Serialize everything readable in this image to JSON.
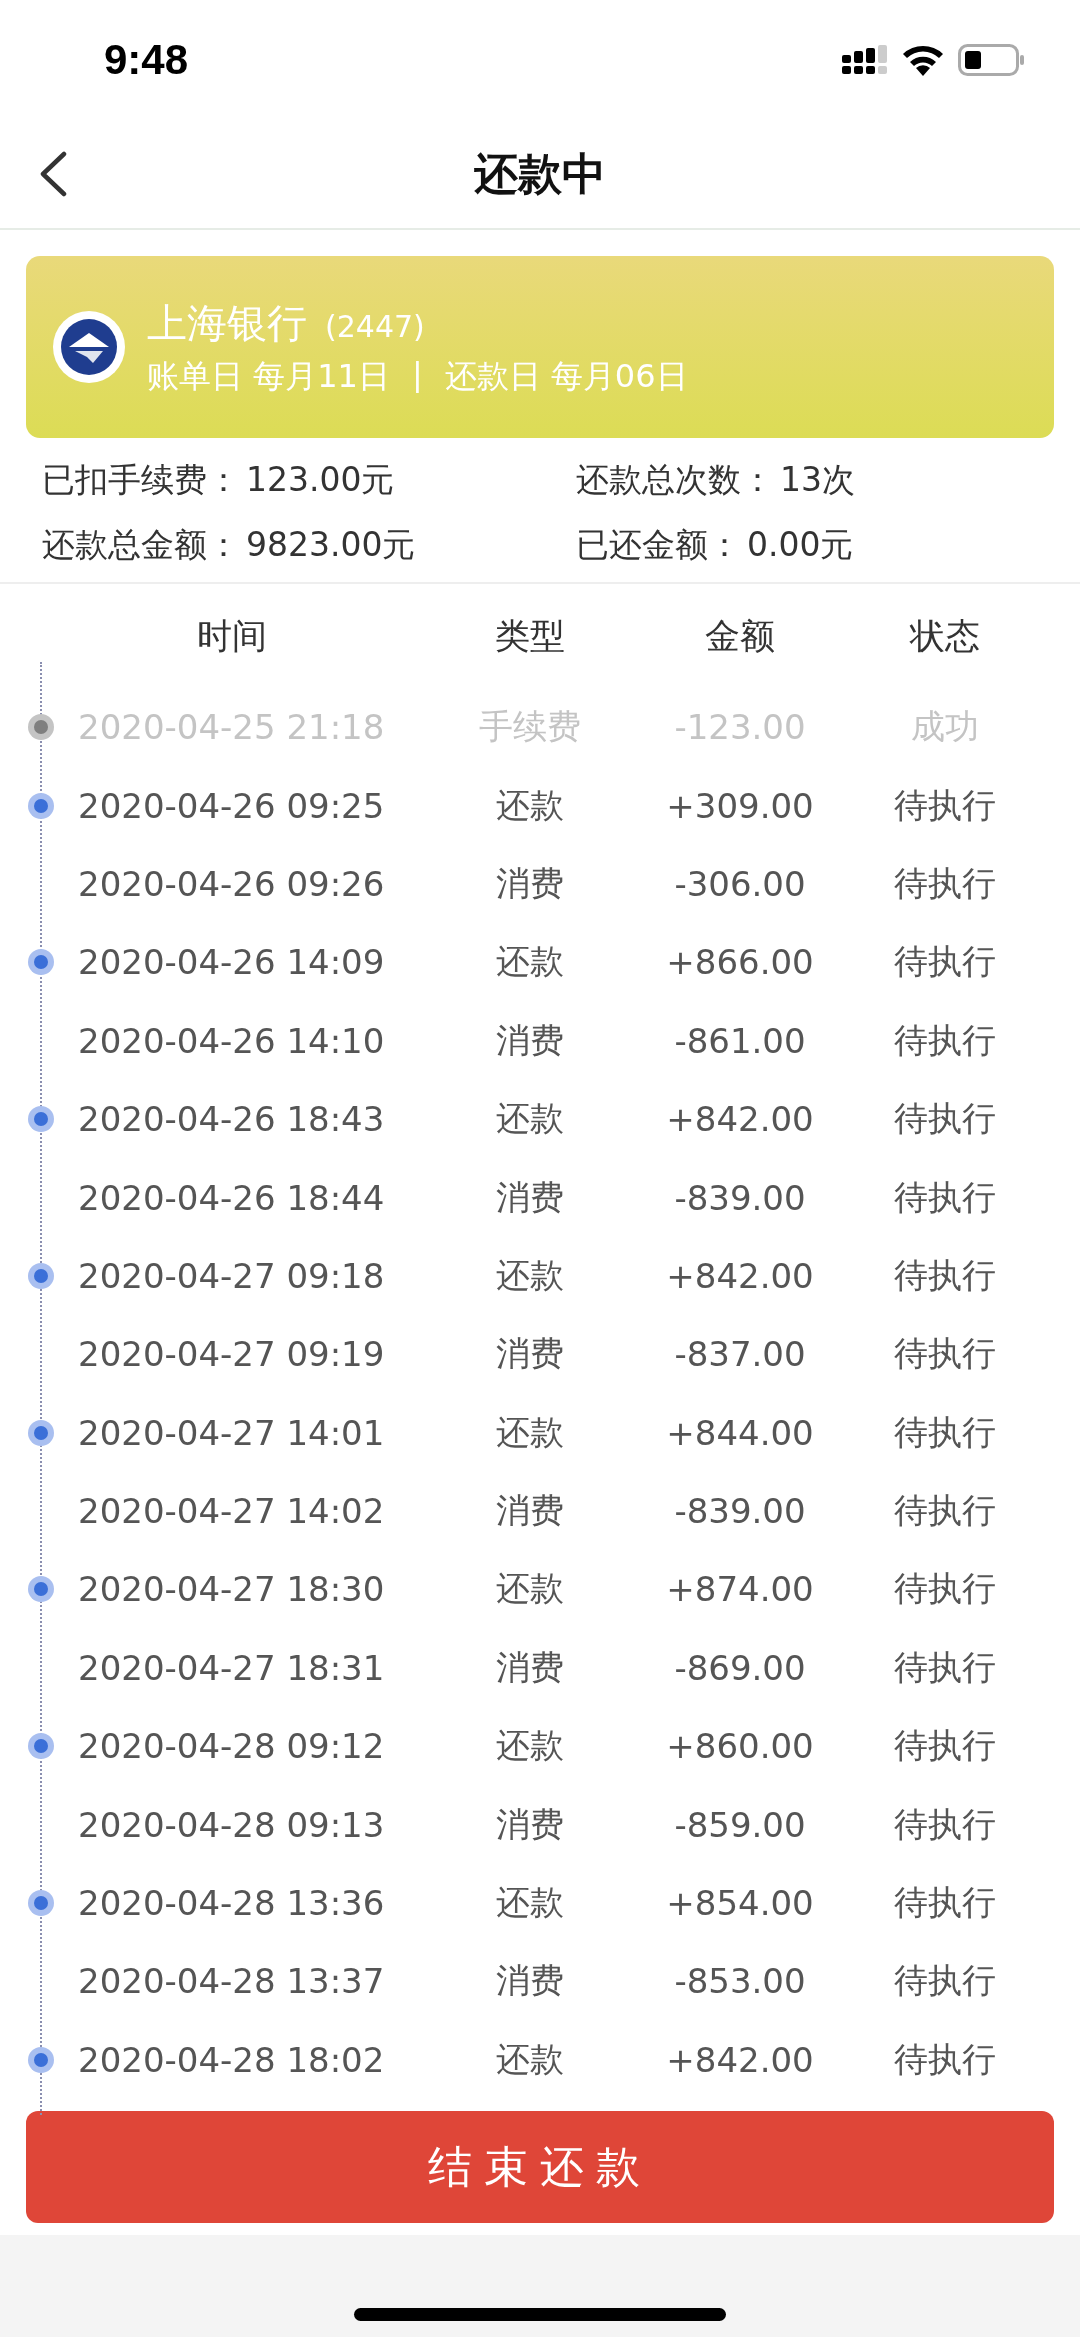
{
  "status_bar": {
    "time": "9:48"
  },
  "nav": {
    "title": "还款中"
  },
  "card": {
    "bank": "上海银行",
    "card_suffix": "(2447)",
    "bill_day": "账单日 每月11日",
    "separator": "|",
    "repay_day": "还款日 每月06日"
  },
  "summary": [
    {
      "label": "已扣手续费：",
      "value": "123.00元"
    },
    {
      "label": "还款总次数：",
      "value": "13次"
    },
    {
      "label": "还款总金额：",
      "value": "9823.00元"
    },
    {
      "label": "已还金额：",
      "value": "0.00元"
    }
  ],
  "table": {
    "columns": [
      "时间",
      "类型",
      "金额",
      "状态"
    ],
    "rows": [
      {
        "kind": "fee",
        "time": "2020-04-25 21:18",
        "type": "手续费",
        "amount": "-123.00",
        "status": "成功"
      },
      {
        "kind": "repay",
        "time": "2020-04-26 09:25",
        "type": "还款",
        "amount": "+309.00",
        "status": "待执行"
      },
      {
        "kind": "spend",
        "time": "2020-04-26 09:26",
        "type": "消费",
        "amount": "-306.00",
        "status": "待执行"
      },
      {
        "kind": "repay",
        "time": "2020-04-26 14:09",
        "type": "还款",
        "amount": "+866.00",
        "status": "待执行"
      },
      {
        "kind": "spend",
        "time": "2020-04-26 14:10",
        "type": "消费",
        "amount": "-861.00",
        "status": "待执行"
      },
      {
        "kind": "repay",
        "time": "2020-04-26 18:43",
        "type": "还款",
        "amount": "+842.00",
        "status": "待执行"
      },
      {
        "kind": "spend",
        "time": "2020-04-26 18:44",
        "type": "消费",
        "amount": "-839.00",
        "status": "待执行"
      },
      {
        "kind": "repay",
        "time": "2020-04-27 09:18",
        "type": "还款",
        "amount": "+842.00",
        "status": "待执行"
      },
      {
        "kind": "spend",
        "time": "2020-04-27 09:19",
        "type": "消费",
        "amount": "-837.00",
        "status": "待执行"
      },
      {
        "kind": "repay",
        "time": "2020-04-27 14:01",
        "type": "还款",
        "amount": "+844.00",
        "status": "待执行"
      },
      {
        "kind": "spend",
        "time": "2020-04-27 14:02",
        "type": "消费",
        "amount": "-839.00",
        "status": "待执行"
      },
      {
        "kind": "repay",
        "time": "2020-04-27 18:30",
        "type": "还款",
        "amount": "+874.00",
        "status": "待执行"
      },
      {
        "kind": "spend",
        "time": "2020-04-27 18:31",
        "type": "消费",
        "amount": "-869.00",
        "status": "待执行"
      },
      {
        "kind": "repay",
        "time": "2020-04-28 09:12",
        "type": "还款",
        "amount": "+860.00",
        "status": "待执行"
      },
      {
        "kind": "spend",
        "time": "2020-04-28 09:13",
        "type": "消费",
        "amount": "-859.00",
        "status": "待执行"
      },
      {
        "kind": "repay",
        "time": "2020-04-28 13:36",
        "type": "还款",
        "amount": "+854.00",
        "status": "待执行"
      },
      {
        "kind": "spend",
        "time": "2020-04-28 13:37",
        "type": "消费",
        "amount": "-853.00",
        "status": "待执行"
      },
      {
        "kind": "repay",
        "time": "2020-04-28 18:02",
        "type": "还款",
        "amount": "+842.00",
        "status": "待执行"
      }
    ]
  },
  "button": {
    "label": "结束还款"
  }
}
